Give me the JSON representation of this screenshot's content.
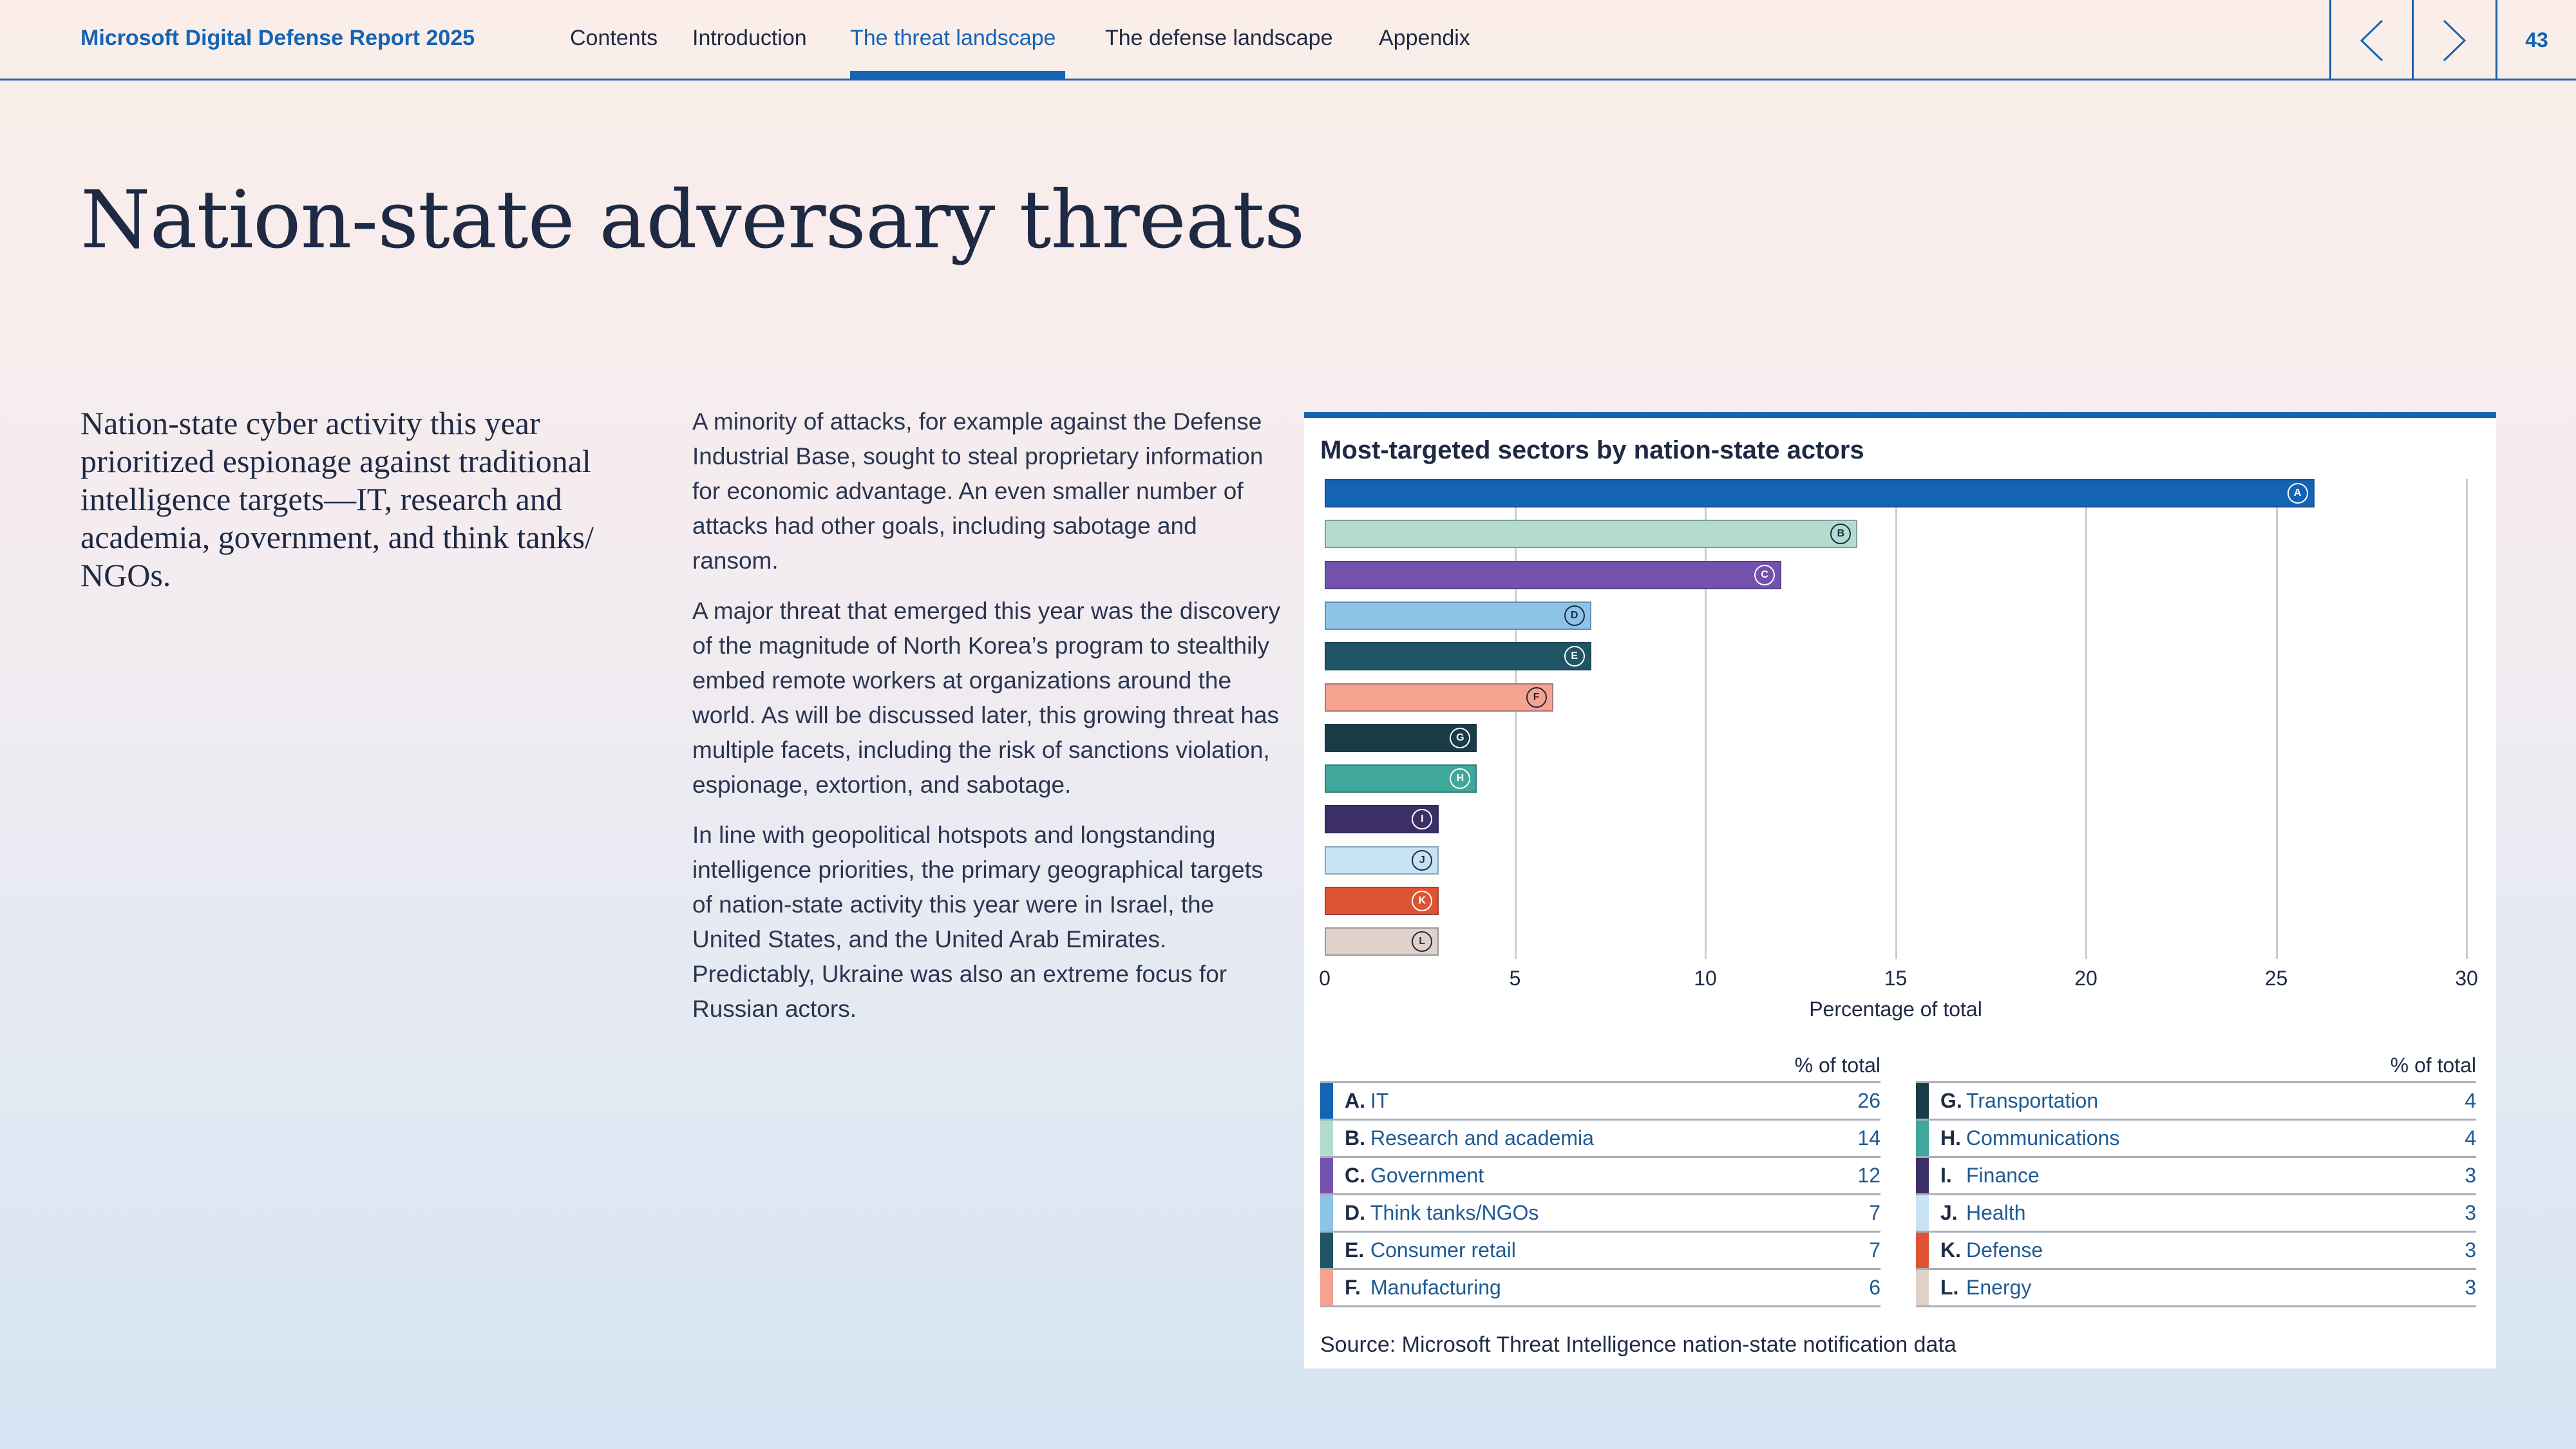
{
  "header": {
    "brand": "Microsoft Digital Defense Report 2025",
    "nav": [
      {
        "label": "Contents"
      },
      {
        "label": "Introduction"
      },
      {
        "label": "The threat landscape"
      },
      {
        "label": "The defense landscape"
      },
      {
        "label": "Appendix"
      }
    ],
    "active_nav": "The threat landscape",
    "page_number": "43",
    "accent_color": "#1463b5"
  },
  "page": {
    "title": "Nation-state adversary threats",
    "lead": "Nation-state cyber activity this year prioritized espionage against traditional intelligence targets—IT, research and academia, government, and think tanks/ NGOs.",
    "paragraphs": [
      "A minority of attacks, for example against the Defense Industrial Base, sought to steal proprietary information for economic advantage. An even smaller number of attacks had other goals, including sabotage and ransom.",
      "A major threat that emerged this year was the discovery of the magnitude of North Korea’s program to stealthily embed remote workers at organizations around the world. As will be discussed later, this growing threat has multiple facets, including the risk of sanctions violation, espionage, extortion, and sabotage.",
      "In line with geopolitical hotspots and longstanding intelligence priorities, the primary geographical targets of nation-state activity this year were in Israel, the United States, and the United Arab Emirates. Predictably, Ukraine was also an extreme focus for Russian actors."
    ]
  },
  "chart": {
    "legend_header": "% of total",
    "source": "Source: Microsoft Threat Intelligence nation-state notification data"
  },
  "chart_data": {
    "type": "bar",
    "orientation": "horizontal",
    "title": "Most-targeted sectors by nation-state actors",
    "xlabel": "Percentage of total",
    "ylabel": "",
    "xlim": [
      0,
      30
    ],
    "xticks": [
      "0",
      "5",
      "10",
      "15",
      "20",
      "25",
      "30"
    ],
    "grid": true,
    "categories": [
      "A",
      "B",
      "C",
      "D",
      "E",
      "F",
      "G",
      "H",
      "I",
      "J",
      "K",
      "L"
    ],
    "sectors": [
      {
        "letter": "A",
        "name": "IT",
        "value": 26,
        "color": "#1463b5"
      },
      {
        "letter": "B",
        "name": "Research and academia",
        "value": 14,
        "color": "#b3dccf"
      },
      {
        "letter": "C",
        "name": "Government",
        "value": 12,
        "color": "#7352ae"
      },
      {
        "letter": "D",
        "name": "Think tanks/NGOs",
        "value": 7,
        "color": "#8cc4e8"
      },
      {
        "letter": "E",
        "name": "Consumer retail",
        "value": 7,
        "color": "#1f5564"
      },
      {
        "letter": "F",
        "name": "Manufacturing",
        "value": 6,
        "color": "#f6a290"
      },
      {
        "letter": "G",
        "name": "Transportation",
        "value": 4,
        "color": "#1a3c47"
      },
      {
        "letter": "H",
        "name": "Communications",
        "value": 4,
        "color": "#3fa89a"
      },
      {
        "letter": "I",
        "name": "Finance",
        "value": 3,
        "color": "#3b2f66"
      },
      {
        "letter": "J",
        "name": "Health",
        "value": 3,
        "color": "#c8e3f4"
      },
      {
        "letter": "K",
        "name": "Defense",
        "value": 3,
        "color": "#de5433"
      },
      {
        "letter": "L",
        "name": "Energy",
        "value": 3,
        "color": "#e0d2c8"
      }
    ]
  }
}
